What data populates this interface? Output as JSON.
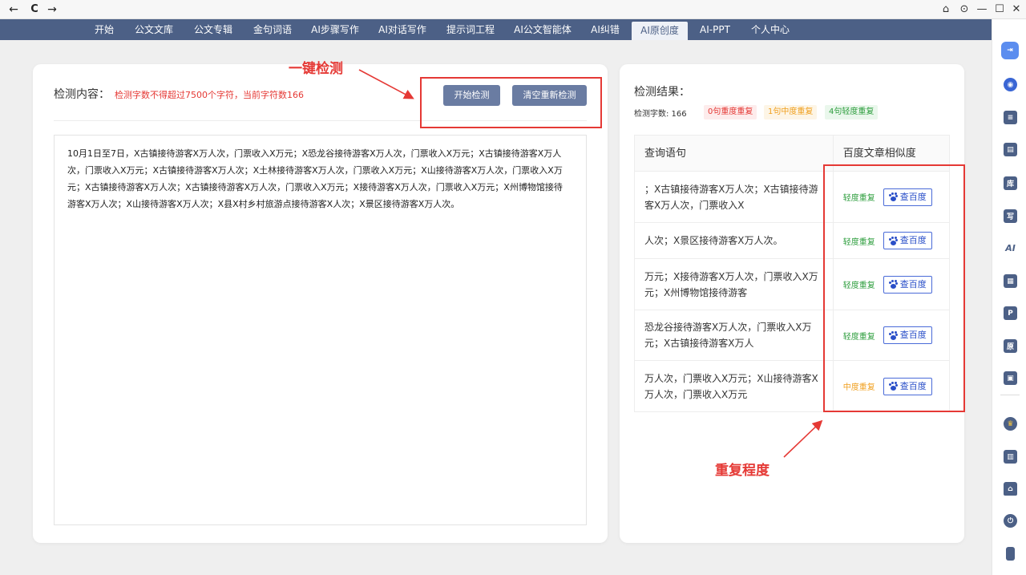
{
  "browser": {
    "back_glyph": "←",
    "reload_glyph": "C",
    "forward_glyph": "→",
    "home_glyph": "⌂",
    "settings_glyph": "⊙",
    "minimize_glyph": "—",
    "maximize_glyph": "☐",
    "close_glyph": "✕"
  },
  "menu": {
    "items": [
      "开始",
      "公文文库",
      "公文专辑",
      "金句词语",
      "AI步骤写作",
      "AI对话写作",
      "提示词工程",
      "AI公文智能体",
      "AI纠错",
      "AI原创度",
      "AI-PPT",
      "个人中心"
    ],
    "active_index": 9
  },
  "left": {
    "title": "检测内容：",
    "hint": "检测字数不得超过7500个字符，当前字符数166",
    "start_button": "开始检测",
    "clear_button": "清空重新检测",
    "content_lines": [
      "10月1日至7日，X古镇接待游客X万人次，门票收入X万元；X恐龙谷接待游客X万人次，门票收入X万元；X古镇接待游客X万人",
      "次，门票收入X万元；X古镇接待游客X万人次；X土林接待游客X万人次，门票收入X万元；X山接待游客X万人次，门票收入X万",
      "元；X古镇接待游客X万人次；X古镇接待游客X万人次，门票收入X万元；X接待游客X万人次，门票收入X万元；X州博物馆接待",
      "游客X万人次；X山接待游客X万人次；X县X村乡村旅游点接待游客X人次；X景区接待游客X万人次。"
    ]
  },
  "right": {
    "title": "检测结果：",
    "count_label": "检测字数: 166",
    "tags": {
      "heavy": "0句重度重复",
      "mid": "1句中度重复",
      "light": "4句轻度重复"
    },
    "table": {
      "col_sentence": "查询语句",
      "col_similarity": "百度文章相似度",
      "baidu_button": "查百度",
      "rows": [
        {
          "sentence": "；X古镇接待游客X万人次；X古镇接待游客X万人次，门票收入X",
          "level": "轻度重复",
          "severity": "light"
        },
        {
          "sentence": "人次；X景区接待游客X万人次。",
          "level": "轻度重复",
          "severity": "light"
        },
        {
          "sentence": "万元；X接待游客X万人次，门票收入X万元；X州博物馆接待游客",
          "level": "轻度重复",
          "severity": "light"
        },
        {
          "sentence": "恐龙谷接待游客X万人次，门票收入X万元；X古镇接待游客X万人",
          "level": "轻度重复",
          "severity": "light"
        },
        {
          "sentence": "万人次，门票收入X万元；X山接待游客X万人次，门票收入X万元",
          "level": "中度重复",
          "severity": "mid"
        }
      ]
    }
  },
  "annotations": {
    "one_click": "一键检测",
    "repeat_degree": "重复程度"
  },
  "sidebar": {
    "icons": [
      "login-icon",
      "globe-icon",
      "briefcase-icon",
      "document-icon",
      "library-icon",
      "write-icon",
      "ai-icon",
      "file-icon",
      "p-icon",
      "original-icon",
      "gift-icon",
      "crown-icon",
      "chart-icon",
      "home-icon",
      "power-icon",
      "phone-icon"
    ]
  },
  "colors": {
    "menu_bg": "#4c6086",
    "accent_red": "#e53935",
    "button": "#6a7ca2",
    "light_green": "#2e9e3e",
    "mid_orange": "#f0a020",
    "baidu_blue": "#2a4fc8"
  }
}
